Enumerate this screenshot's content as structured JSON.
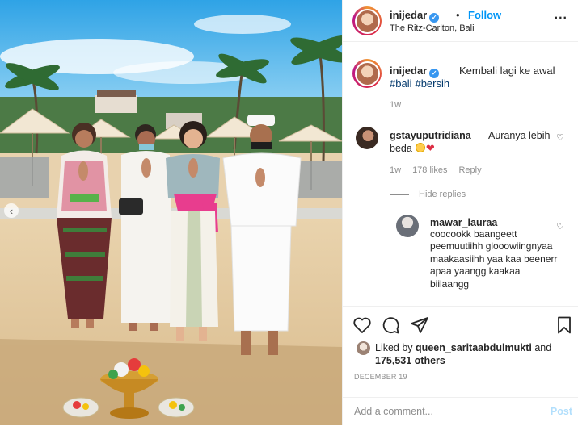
{
  "header": {
    "username": "inijedar",
    "follow_label": "Follow",
    "separator": "•",
    "location": "The Ritz-Carlton, Bali",
    "more_icon": "..."
  },
  "caption": {
    "username": "inijedar",
    "text": "Kembali lagi ke awal",
    "hashtags": [
      "#bali",
      "#bersih"
    ],
    "time": "1w"
  },
  "comments": [
    {
      "username": "gstayuputridiana",
      "text": "Auranya lebih",
      "text_line2": "beda",
      "emojis": [
        "smiling-face",
        "red-heart"
      ],
      "time": "1w",
      "likes": "178 likes",
      "reply_label": "Reply",
      "hide_replies_label": "Hide replies"
    }
  ],
  "reply": {
    "username": "mawar_lauraa",
    "text": "coocookk baangeett peemuutiihh glooowiingnyaa maakaasiihh yaa kaa beenerr apaa yaangg kaakaa biilaangg"
  },
  "actions": {
    "liked_prefix": "Liked by",
    "liked_user": "queen_saritaabdulmukti",
    "liked_and": "and",
    "liked_count": "175,531 others",
    "date": "DECEMBER 19",
    "comment_placeholder": "Add a comment...",
    "post_label": "Post"
  },
  "icons": {
    "like": "heart-icon",
    "comment": "comment-icon",
    "share": "paper-plane-icon",
    "save": "bookmark-icon",
    "verified": "verified-badge-icon",
    "carousel_prev": "chevron-left-icon"
  },
  "colors": {
    "link_blue": "#0095f6",
    "hashtag": "#00376b",
    "muted": "#8e8e8e",
    "verified": "#3897f0",
    "post_disabled": "#b2dffc"
  }
}
